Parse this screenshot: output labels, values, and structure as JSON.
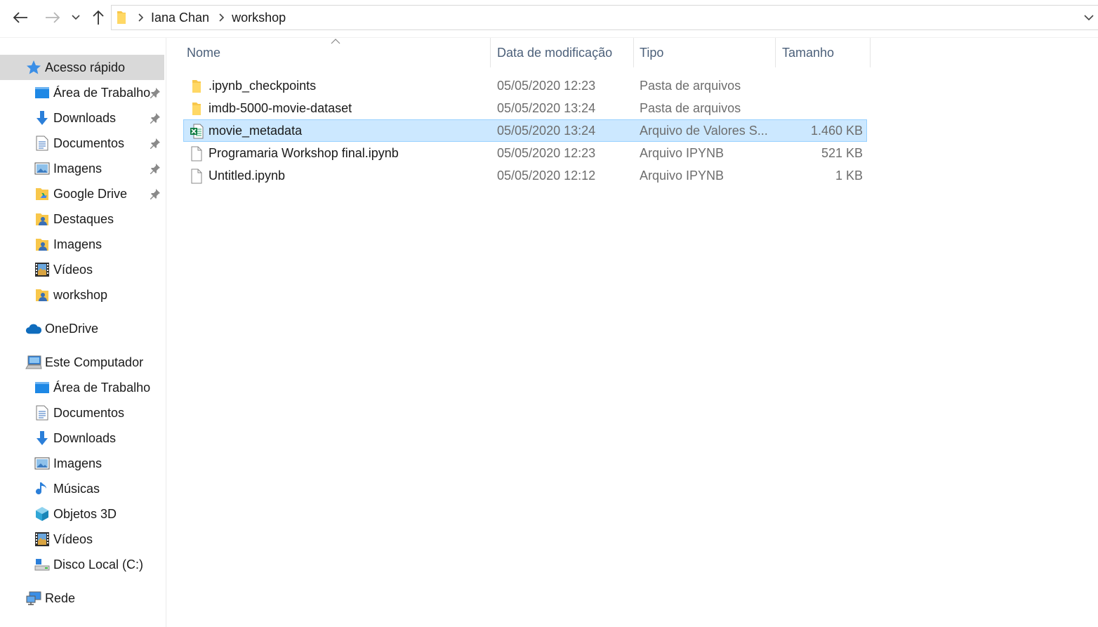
{
  "address": {
    "crumbs": [
      "Iana Chan",
      "workshop"
    ]
  },
  "sidebar": {
    "quick_access": {
      "label": "Acesso rápido",
      "items": [
        {
          "label": "Área de Trabalho",
          "icon": "desktop-icon",
          "pinned": true
        },
        {
          "label": "Downloads",
          "icon": "download-icon",
          "pinned": true
        },
        {
          "label": "Documentos",
          "icon": "document-icon",
          "pinned": true
        },
        {
          "label": "Imagens",
          "icon": "pictures-icon",
          "pinned": true
        },
        {
          "label": "Google Drive",
          "icon": "google-drive-icon",
          "pinned": true
        },
        {
          "label": "Destaques",
          "icon": "shared-folder-icon",
          "pinned": false
        },
        {
          "label": "Imagens",
          "icon": "shared-folder-icon",
          "pinned": false
        },
        {
          "label": "Vídeos",
          "icon": "video-icon",
          "pinned": false
        },
        {
          "label": "workshop",
          "icon": "shared-folder-icon",
          "pinned": false
        }
      ]
    },
    "onedrive": {
      "label": "OneDrive"
    },
    "this_pc": {
      "label": "Este Computador",
      "items": [
        {
          "label": "Área de Trabalho",
          "icon": "desktop-icon"
        },
        {
          "label": "Documentos",
          "icon": "document-icon"
        },
        {
          "label": "Downloads",
          "icon": "download-icon"
        },
        {
          "label": "Imagens",
          "icon": "pictures-icon"
        },
        {
          "label": "Músicas",
          "icon": "music-icon"
        },
        {
          "label": "Objetos 3D",
          "icon": "3d-objects-icon"
        },
        {
          "label": "Vídeos",
          "icon": "video-icon"
        },
        {
          "label": "Disco Local (C:)",
          "icon": "drive-icon"
        }
      ]
    },
    "network": {
      "label": "Rede"
    }
  },
  "columns": {
    "name": "Nome",
    "date": "Data de modificação",
    "type": "Tipo",
    "size": "Tamanho"
  },
  "files": [
    {
      "name": ".ipynb_checkpoints",
      "date": "05/05/2020 12:23",
      "type": "Pasta de arquivos",
      "size": "",
      "icon": "folder-icon",
      "selected": false
    },
    {
      "name": "imdb-5000-movie-dataset",
      "date": "05/05/2020 13:24",
      "type": "Pasta de arquivos",
      "size": "",
      "icon": "folder-icon",
      "selected": false
    },
    {
      "name": "movie_metadata",
      "date": "05/05/2020 13:24",
      "type": "Arquivo de Valores S...",
      "size": "1.460 KB",
      "icon": "excel-csv-icon",
      "selected": true
    },
    {
      "name": "Programaria Workshop final.ipynb",
      "date": "05/05/2020 12:23",
      "type": "Arquivo IPYNB",
      "size": "521 KB",
      "icon": "blank-file-icon",
      "selected": false
    },
    {
      "name": "Untitled.ipynb",
      "date": "05/05/2020 12:12",
      "type": "Arquivo IPYNB",
      "size": "1 KB",
      "icon": "blank-file-icon",
      "selected": false
    }
  ],
  "colors": {
    "selection_bg": "#cce8ff",
    "selection_border": "#99d1ff",
    "sidebar_selected": "#d9d9d9",
    "header_text": "#4c607a",
    "folder": "#f8c74b"
  }
}
